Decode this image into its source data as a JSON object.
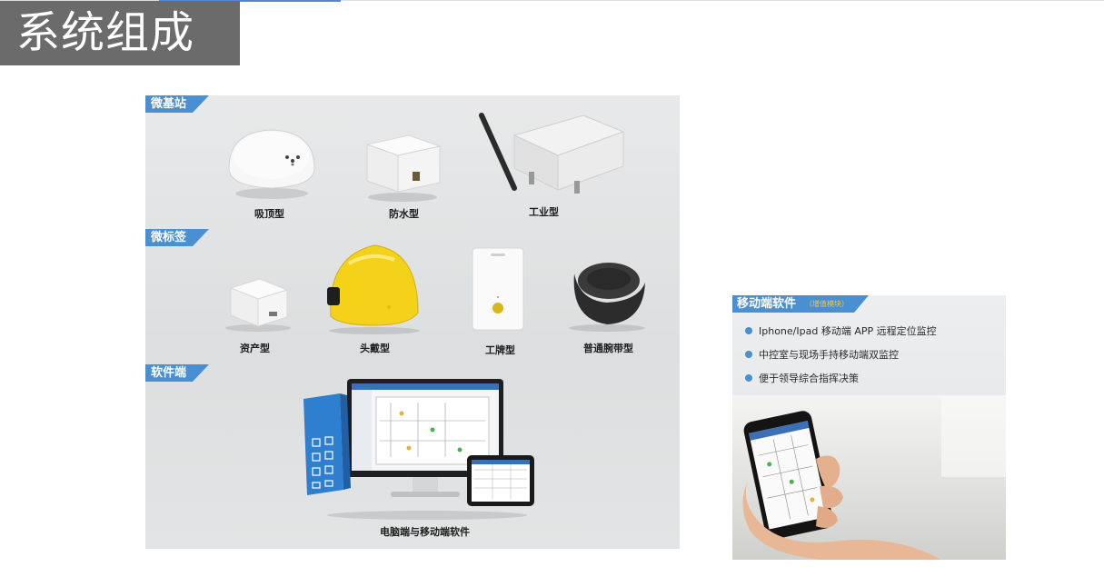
{
  "page": {
    "title": "系统组成"
  },
  "main_panel": {
    "sections": [
      {
        "label": "微基站",
        "items": [
          "吸顶型",
          "防水型",
          "工业型"
        ]
      },
      {
        "label": "微标签",
        "items": [
          "资产型",
          "头戴型",
          "工牌型",
          "普通腕带型"
        ]
      },
      {
        "label": "软件端",
        "items": [
          "电脑端与移动端软件"
        ]
      }
    ]
  },
  "side_panel": {
    "title": "移动端软件",
    "badge": "（增值模块）",
    "bullets": [
      "Iphone/Ipad 移动端 APP 远程定位监控",
      "中控室与现场手持移动端双监控",
      "便于领导综合指挥决策"
    ]
  },
  "colors": {
    "tag_blue": "#4a8fd1",
    "title_gray": "#6b6b6b",
    "helmet_yellow": "#f5d21a"
  }
}
